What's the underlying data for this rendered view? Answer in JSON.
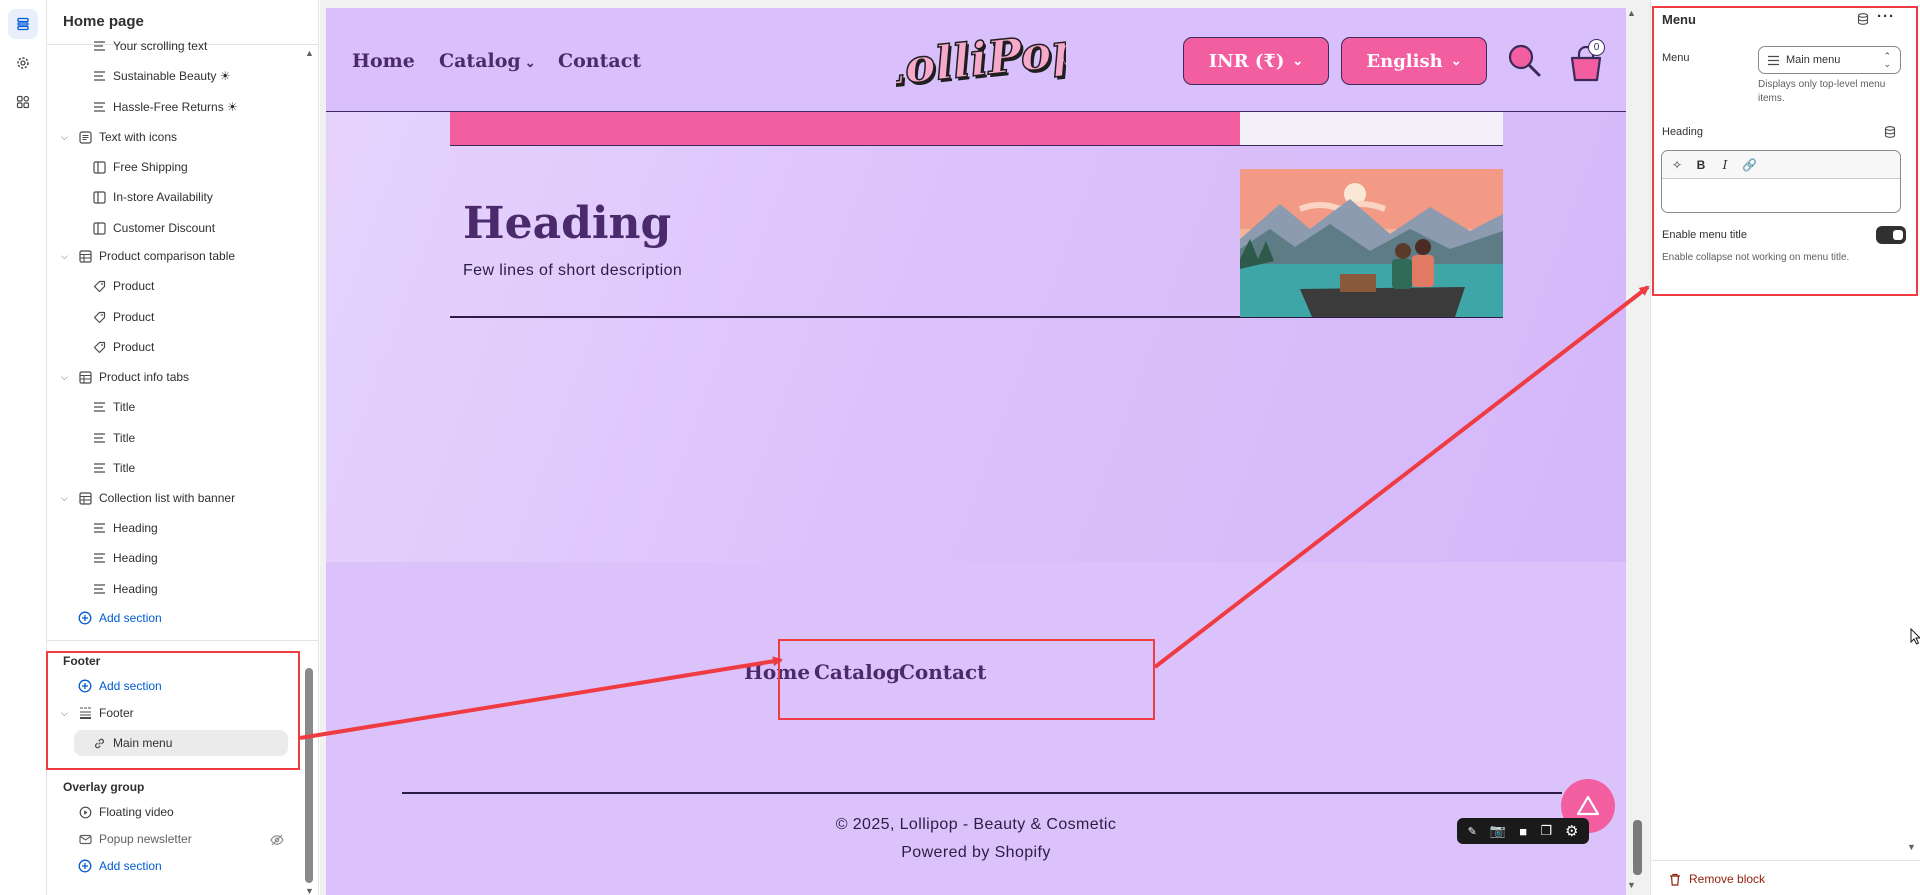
{
  "sidebar": {
    "title": "Home page",
    "items": [
      {
        "label": "Your scrolling text",
        "icon": "text-lines-icon"
      },
      {
        "label": "Sustainable Beauty ☀",
        "icon": "text-lines-icon"
      },
      {
        "label": "Hassle-Free Returns ☀",
        "icon": "text-lines-icon"
      },
      {
        "label": "Text with icons",
        "icon": "section-icon"
      },
      {
        "label": "Free Shipping",
        "icon": "column-icon"
      },
      {
        "label": "In-store Availability",
        "icon": "column-icon"
      },
      {
        "label": "Customer Discount",
        "icon": "column-icon"
      },
      {
        "label": "Product comparison table",
        "icon": "table-icon"
      },
      {
        "label": "Product",
        "icon": "tag-icon"
      },
      {
        "label": "Product",
        "icon": "tag-icon"
      },
      {
        "label": "Product",
        "icon": "tag-icon"
      },
      {
        "label": "Product info tabs",
        "icon": "table-icon"
      },
      {
        "label": "Title",
        "icon": "text-lines-icon"
      },
      {
        "label": "Title",
        "icon": "text-lines-icon"
      },
      {
        "label": "Title",
        "icon": "text-lines-icon"
      },
      {
        "label": "Collection list with banner",
        "icon": "table-icon"
      },
      {
        "label": "Heading",
        "icon": "text-lines-icon"
      },
      {
        "label": "Heading",
        "icon": "text-lines-icon"
      },
      {
        "label": "Heading",
        "icon": "text-lines-icon"
      }
    ],
    "add_section": "Add section",
    "footer_group": {
      "label": "Footer",
      "add_section": "Add section",
      "section": "Footer",
      "block": "Main menu"
    },
    "overlay_group": {
      "label": "Overlay group",
      "items": [
        "Floating video",
        "Popup newsletter"
      ],
      "add_section": "Add section"
    }
  },
  "preview": {
    "nav": [
      "Home",
      "Catalog",
      "Contact"
    ],
    "logo_text": "LolliPop",
    "currency": "INR (₹)",
    "language": "English",
    "cart_count": "0",
    "hero": {
      "heading": "Heading",
      "description": "Few lines of short description"
    },
    "footer_menu": [
      "Home",
      "Catalog",
      "Contact"
    ],
    "copyright": "© 2025, Lollipop - Beauty & Cosmetic",
    "powered_by": "Powered by Shopify"
  },
  "panel": {
    "title": "Menu",
    "menu_label": "Menu",
    "menu_value": "Main menu",
    "menu_help": "Displays only top-level menu items.",
    "heading_label": "Heading",
    "enable_title_label": "Enable menu title",
    "enable_title_on": true,
    "enable_title_help": "Enable collapse not working on menu title.",
    "remove_block": "Remove block"
  },
  "colors": {
    "accent_pink": "#f35ea1",
    "lavender": "#dcc2fb",
    "purple_text": "#4b2a6b",
    "annotation_red": "#ef3b42",
    "link_blue": "#005bd3"
  }
}
